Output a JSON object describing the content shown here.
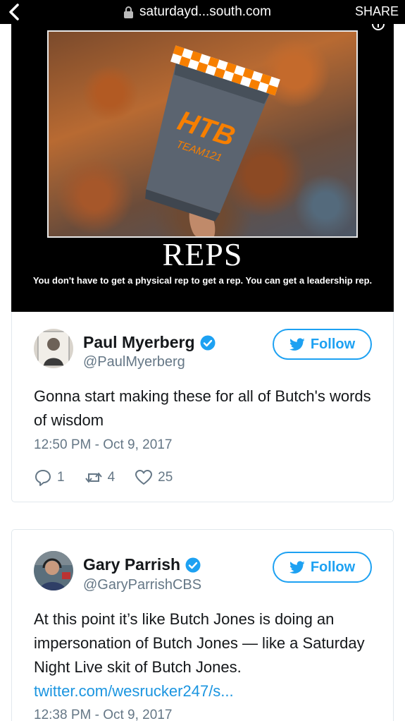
{
  "browser": {
    "url": "saturdayd...south.com",
    "share_label": "SHARE"
  },
  "poster": {
    "title": "REPS",
    "caption": "You don't have to get a physical rep to get a rep. You can get a leadership rep.",
    "can_text": "HTB",
    "can_subtext": "TEAM121"
  },
  "tweets": [
    {
      "name": "Paul Myerberg",
      "handle": "@PaulMyerberg",
      "follow_label": "Follow",
      "text": "Gonna start making these for all of Butch's words of wisdom",
      "timestamp": "12:50 PM - Oct 9, 2017",
      "replies": "1",
      "retweets": "4",
      "likes": "25"
    },
    {
      "name": "Gary Parrish",
      "handle": "@GaryParrishCBS",
      "follow_label": "Follow",
      "text": "At this point it’s like Butch Jones is doing an impersonation of Butch Jones — like a Saturday Night Live skit of Butch Jones.",
      "link": "twitter.com/wesrucker247/s...",
      "timestamp": "12:38 PM - Oct 9, 2017"
    }
  ],
  "colors": {
    "accent": "#1da1f2",
    "link": "#1b95e0",
    "secondary_text": "#657786",
    "card_border": "#e1e8ed",
    "can_orange": "#f77f00"
  }
}
